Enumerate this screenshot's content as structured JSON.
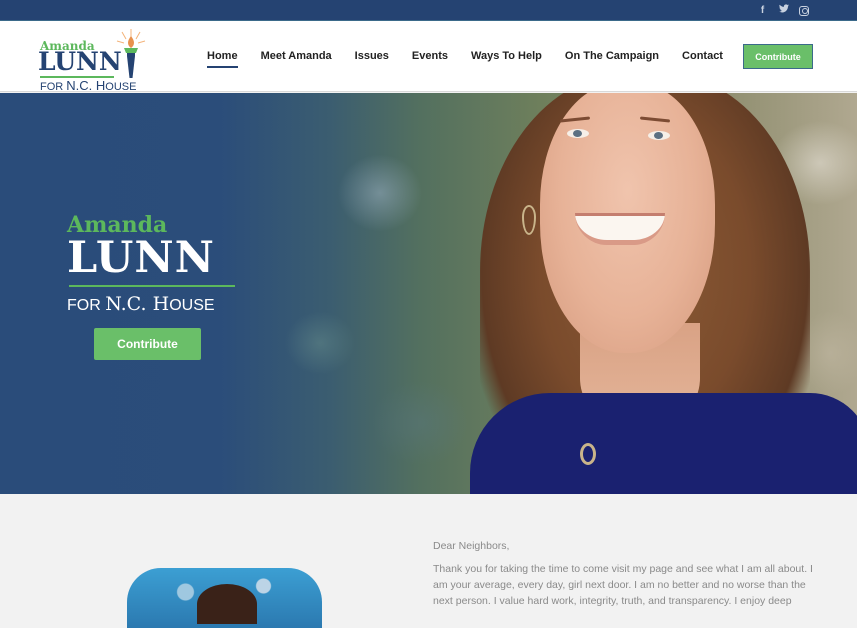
{
  "topbar": {
    "social": [
      {
        "icon": "facebook-icon",
        "glyph": "f"
      },
      {
        "icon": "twitter-icon",
        "glyph": "•"
      },
      {
        "icon": "instagram-icon",
        "glyph": ""
      }
    ]
  },
  "logo": {
    "first": "Amanda",
    "last": "LUNN",
    "sub_small_1": "FOR ",
    "sub_big": "N.C. H",
    "sub_small_2": "OUSE"
  },
  "nav": {
    "items": [
      {
        "label": "Home",
        "active": true
      },
      {
        "label": "Meet Amanda"
      },
      {
        "label": "Issues"
      },
      {
        "label": "Events"
      },
      {
        "label": "Ways To Help"
      },
      {
        "label": "On The Campaign"
      },
      {
        "label": "Contact"
      }
    ],
    "contribute_label": "Contribute"
  },
  "hero": {
    "first": "Amanda",
    "last": "LUNN",
    "sub_small_1": "FOR ",
    "sub_big": "N.C. H",
    "sub_small_2": "OUSE",
    "button_label": "Contribute"
  },
  "colors": {
    "brand_navy": "#254372",
    "brand_green": "#6abf69"
  },
  "letter": {
    "greeting": "Dear Neighbors,",
    "body": "Thank you for taking the time to come visit my page and see what I am all about.  I am your average, every day, girl next door.  I am no better and no worse than the next person.  I value hard work, integrity, truth, and transparency.  I enjoy deep"
  }
}
